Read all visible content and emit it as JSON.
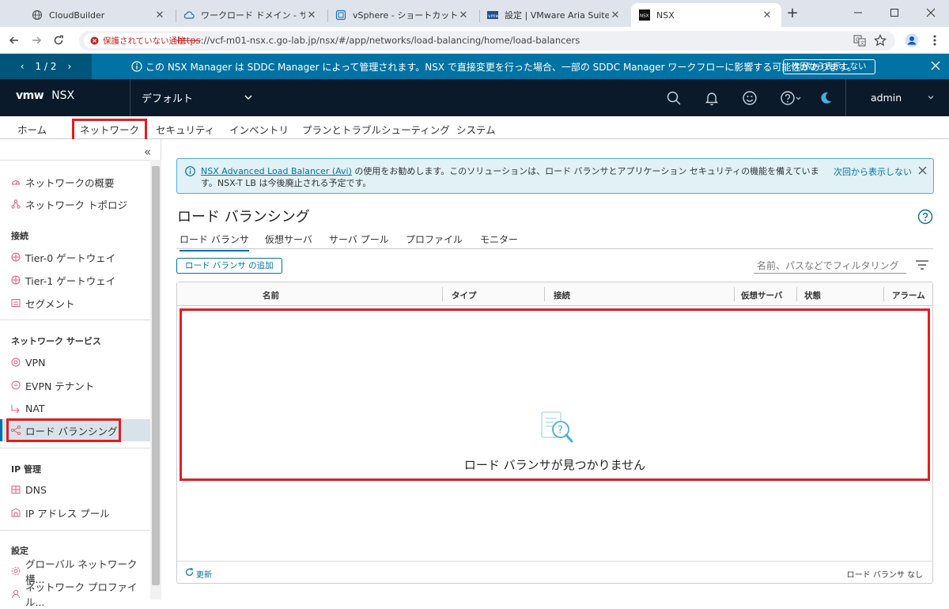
{
  "browser": {
    "tabs": [
      {
        "title": "CloudBuilder",
        "icon": "globe-icon"
      },
      {
        "title": "ワークロード ドメイン - サービス",
        "icon": "cloud-icon"
      },
      {
        "title": "vSphere - ショートカット",
        "icon": "vsphere-icon"
      },
      {
        "title": "設定 | VMware Aria Suite Lifecycle",
        "icon": "vmware-icon"
      },
      {
        "title": "NSX",
        "icon": "nsx-icon"
      }
    ],
    "security_label": "保護されていない通信",
    "url_scheme": "https",
    "url_rest": "://vcf-m01-nsx.c.go-lab.jp/nsx/#/app/networks/load-balancing/home/load-balancers"
  },
  "banner": {
    "pager": "1 / 2",
    "message": "この NSX Manager は SDDC Manager によって管理されます。NSX で直接変更を行った場合、一部の SDDC Manager ワークフローに影響する可能性があります。",
    "dismiss": "次回から表示しない",
    "color": "#0072a3"
  },
  "header": {
    "logo": "vmw",
    "product": "NSX",
    "context": "デフォルト",
    "user": "admin"
  },
  "nav": {
    "items": [
      "ホーム",
      "ネットワーク",
      "セキュリティ",
      "インベントリ",
      "プランとトラブルシューティング",
      "システム"
    ],
    "active": "ネットワーク"
  },
  "sidebar": {
    "top_items": [
      "ネットワークの概要",
      "ネットワーク トポロジ"
    ],
    "sections": [
      {
        "header": "接続",
        "items": [
          "Tier-0 ゲートウェイ",
          "Tier-1 ゲートウェイ",
          "セグメント"
        ]
      },
      {
        "header": "ネットワーク サービス",
        "items": [
          "VPN",
          "EVPN テナント",
          "NAT",
          "ロード バランシング"
        ]
      },
      {
        "header": "IP 管理",
        "items": [
          "DNS",
          "IP アドレス プール"
        ]
      },
      {
        "header": "設定",
        "items": [
          "グローバル ネットワーク構...",
          "ネットワーク プロファイル..."
        ]
      }
    ],
    "selected": "ロード バランシング"
  },
  "alert": {
    "link_text": "NSX Advanced Load Balancer (Avi)",
    "text": " の使用をお勧めします。このソリューションは、ロード バランサとアプリケーション セキュリティの機能を備えています。NSX-T LB は今後廃止される予定です。",
    "dismiss": "次回から表示しない"
  },
  "page": {
    "title": "ロード バランシング",
    "subtabs": [
      "ロード バランサ",
      "仮想サーバ",
      "サーバ プール",
      "プロファイル",
      "モニター"
    ],
    "active_subtab": "ロード バランサ",
    "add_button": "ロード バランサ の追加",
    "filter_placeholder": "名前、パスなどでフィルタリング"
  },
  "grid": {
    "columns": [
      "名前",
      "タイプ",
      "接続",
      "仮想サーバ",
      "状態",
      "アラーム"
    ],
    "empty_message": "ロード バランサが見つかりません",
    "refresh": "更新",
    "footer_count": "ロード バランサ なし"
  }
}
